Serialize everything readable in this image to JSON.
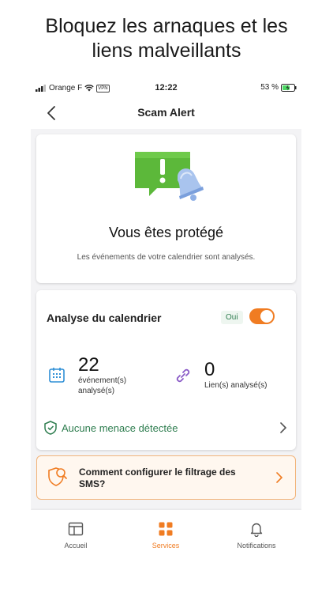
{
  "headline": {
    "line1": "Bloquez les arnaques et les",
    "line2": "liens malveillants"
  },
  "status_bar": {
    "carrier": "Orange F",
    "vpn": "VPN",
    "time": "12:22",
    "battery": "53 %"
  },
  "nav": {
    "title": "Scam Alert",
    "back_icon": "chevron-left-icon"
  },
  "hero": {
    "title": "Vous êtes protégé",
    "subtitle": "Les événements de votre calendrier sont analysés.",
    "icon": "alert-bell-icon"
  },
  "calendar": {
    "title": "Analyse du calendrier",
    "toggle_label": "Oui",
    "toggle_on": true,
    "events_count": "22",
    "events_label": "événement(s) analysé(s)",
    "links_count": "0",
    "links_label": "Lien(s) analysé(s)",
    "status": "Aucune menace détectée"
  },
  "sms_help": {
    "label": "Comment configurer le filtrage des SMS?"
  },
  "tabs": [
    {
      "label": "Accueil",
      "icon": "home-layout-icon",
      "active": false
    },
    {
      "label": "Services",
      "icon": "grid-icon",
      "active": true
    },
    {
      "label": "Notifications",
      "icon": "bell-icon",
      "active": false
    }
  ],
  "colors": {
    "accent": "#f07c22",
    "success": "#2e7d4f",
    "info": "#2f8fd6",
    "link": "#8b5cc7",
    "alert_green": "#5cb83a"
  }
}
